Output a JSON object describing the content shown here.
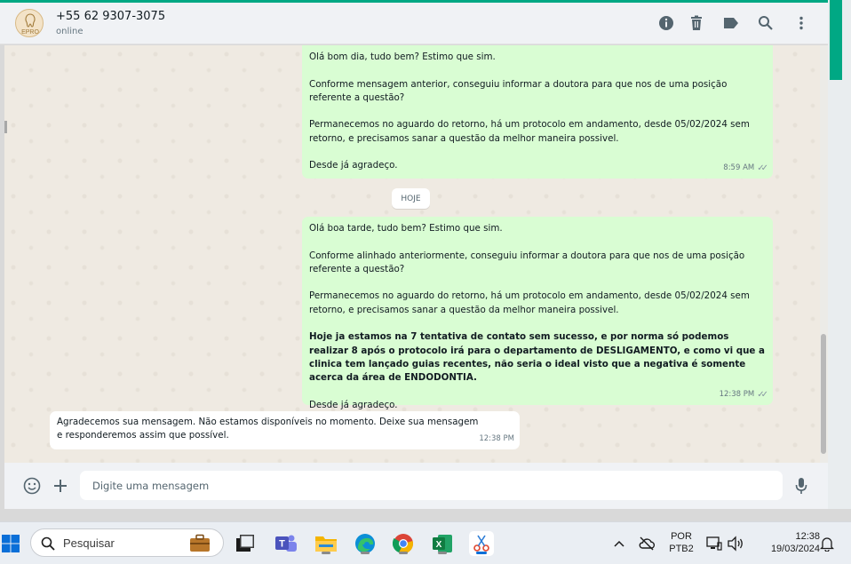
{
  "colors": {
    "accent": "#00a884",
    "outgoing_bubble": "#d9fdd3",
    "incoming_bubble": "#ffffff",
    "chat_bg": "#efeae2",
    "header_bg": "#f0f2f5"
  },
  "header": {
    "contact_name": "+55 62 9307-3075",
    "status": "online",
    "avatar_text": "EPRO",
    "icons": [
      "info-icon",
      "trash-icon",
      "label-icon",
      "search-icon",
      "menu-icon"
    ]
  },
  "chat": {
    "day_separator": "HOJE",
    "messages": [
      {
        "direction": "out",
        "paragraphs": [
          "Olá bom dia, tudo bem? Estimo que sim.",
          "Conforme mensagem anterior, conseguiu informar a doutora para que nos de uma posição referente a questão?",
          "Permanecemos no aguardo do retorno, há um protocolo em andamento, desde 05/02/2024 sem retorno, e precisamos sanar a questão da melhor maneira possivel.",
          "Desde já agradeço."
        ],
        "time": "8:59 AM"
      },
      {
        "direction": "out",
        "paragraphs": [
          "Olá boa tarde, tudo bem? Estimo que sim.",
          "Conforme alinhado anteriormente, conseguiu informar a doutora para que nos de uma posição referente a questão?",
          "Permanecemos no aguardo do retorno, há um protocolo em andamento, desde 05/02/2024 sem retorno, e precisamos sanar a questão da melhor maneira possivel.",
          "Hoje ja estamos na 7 tentativa de contato sem sucesso, e por norma só podemos realizar 8 após o protocolo irá para o departamento de DESLIGAMENTO, e como vi que a clinica tem lançado guias recentes, não seria o ideal visto que a negativa é somente acerca da área de ENDODONTIA.",
          "Desde já agradeço."
        ],
        "bold_paragraph": 3,
        "time": "12:38 PM"
      },
      {
        "direction": "in",
        "paragraphs": [
          "Agradecemos sua mensagem. Não estamos disponíveis no momento. Deixe sua mensagem e responderemos assim que possível."
        ],
        "time": "12:38 PM"
      }
    ]
  },
  "composer": {
    "placeholder": "Digite uma mensagem",
    "value": ""
  },
  "taskbar": {
    "search_label": "Pesquisar",
    "apps": [
      "start-icon",
      "search-icon",
      "briefcase-icon",
      "task-view-icon",
      "teams-icon",
      "file-explorer-icon",
      "edge-icon",
      "chrome-icon",
      "excel-icon",
      "snipping-tool-icon"
    ],
    "tray": {
      "language": "POR",
      "layout": "PTB2",
      "time": "12:38",
      "date": "19/03/2024"
    }
  }
}
